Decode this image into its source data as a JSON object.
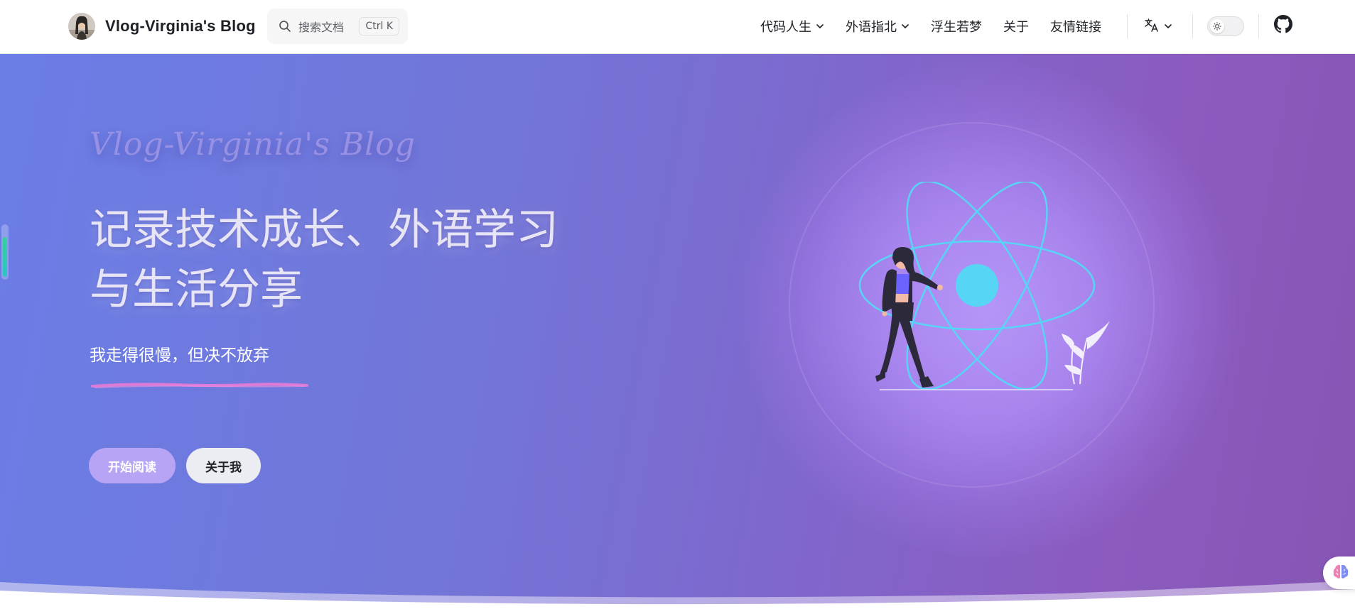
{
  "nav": {
    "brand_title": "Vlog-Virginia's Blog",
    "avatar_icon": "avatar-photo",
    "search": {
      "placeholder": "搜索文档",
      "shortcut": "Ctrl K",
      "icon": "search-icon"
    },
    "menu": [
      {
        "label": "代码人生",
        "has_dropdown": true
      },
      {
        "label": "外语指北",
        "has_dropdown": true
      },
      {
        "label": "浮生若梦",
        "has_dropdown": false
      },
      {
        "label": "关于",
        "has_dropdown": false
      },
      {
        "label": "友情链接",
        "has_dropdown": false
      }
    ],
    "language_icon": "translate-icon",
    "theme_toggle_icon": "sun-icon",
    "github_icon": "github-icon"
  },
  "hero": {
    "script_title": "Vlog-Virginia's Blog",
    "headline_line1": "记录技术成长、外语学习",
    "headline_line2": "与生活分享",
    "tagline": "我走得很慢，但决不放弃",
    "primary_button": "开始阅读",
    "secondary_button": "关于我",
    "illustration": "woman-walking-atom-illustration",
    "float_widget_icon": "brain-icon"
  },
  "colors": {
    "hero_gradient_start": "#6a7ee6",
    "hero_gradient_end": "#8656b4",
    "atom_color": "#56d5f5",
    "primary_button": "#b7a4f5",
    "underline_accent": "#e27ad6",
    "progress_fill": "#31d39a"
  }
}
